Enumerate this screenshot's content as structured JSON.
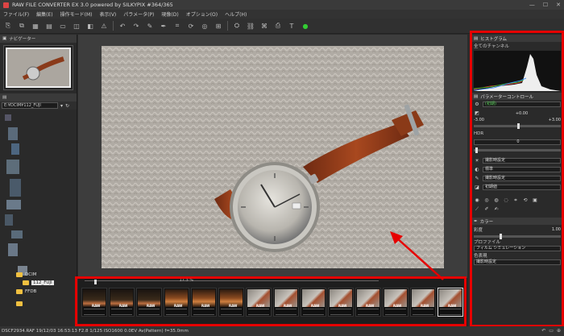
{
  "window": {
    "title": "RAW FILE CONVERTER EX 3.0 powered by SILKYPIX    #364/365"
  },
  "menu": [
    "ファイル(F)",
    "編集(E)",
    "操作モード(M)",
    "表示(V)",
    "パラメータ(P)",
    "現像(D)",
    "オプション(O)",
    "ヘルプ(H)"
  ],
  "navigator": {
    "title": "ナビゲーター"
  },
  "folder": {
    "path": "E:¥DCIM¥112_FUJI",
    "items": [
      {
        "name": "DCIM"
      },
      {
        "name": "112_FUJI"
      },
      {
        "name": "FFDB"
      }
    ]
  },
  "filmstrip": {
    "zoom": "17.3 %",
    "raw_badge": "RAW"
  },
  "histogram": {
    "title": "ヒストグラム",
    "channel": "全てのチャンネル"
  },
  "params": {
    "title": "パラメーターコントロール",
    "preset": "(初期)",
    "exposure_value": "+0.00",
    "exposure_min": "-3.00",
    "exposure_max": "+3.00",
    "hdr_label": "HDR",
    "hdr_value": "0",
    "wb": "撮影時設定",
    "tone": "標準",
    "sharp": "撮影時設定",
    "noise": "初期値"
  },
  "color": {
    "title": "カラー",
    "saturation_label": "彩度",
    "saturation_value": "1.00",
    "profile_label": "プロファイル",
    "profile_value": "フィルム シミュレーション",
    "colorfx_label": "色表現",
    "colorfx_value": "撮影時設定"
  },
  "status": {
    "text": "DSCF2934.RAF 19/12/03 16:53:13 F2.8 1/125 ISO1600  0.0EV Av(Pattern) f=35.0mm"
  },
  "colors": {
    "accent_red": "#e60000",
    "ok_green": "#33cc33"
  }
}
